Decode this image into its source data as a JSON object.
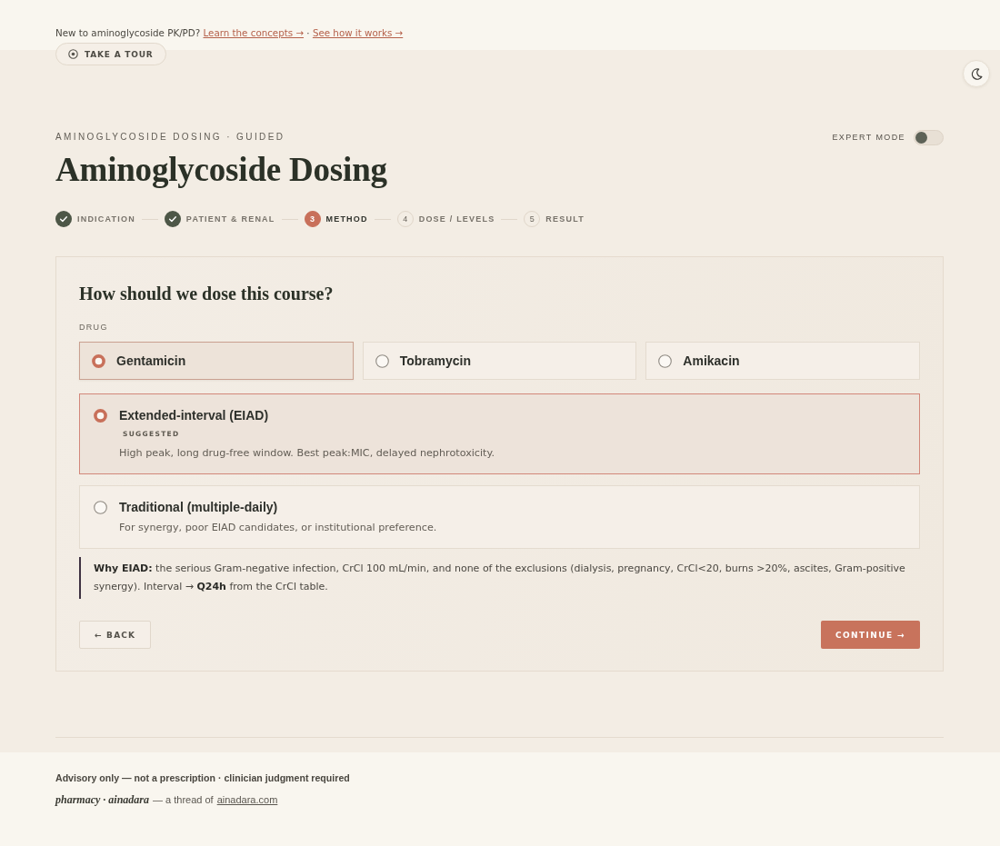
{
  "intro": {
    "text": "New to aminoglycoside PK/PD?",
    "links": [
      {
        "label": "Learn the concepts →"
      },
      {
        "label": "See how it works →"
      }
    ],
    "separator": "·"
  },
  "tour_button": {
    "label": "TAKE A TOUR"
  },
  "header": {
    "eyebrow": "AMINOGLYCOSIDE DOSING · GUIDED",
    "title": "Aminoglycoside Dosing",
    "expert_mode": {
      "label": "EXPERT MODE",
      "on": false
    }
  },
  "steps": [
    {
      "label": "INDICATION",
      "completed": true,
      "selected": false
    },
    {
      "label": "PATIENT & RENAL",
      "completed": true,
      "selected": false
    },
    {
      "number": "3",
      "label": "METHOD",
      "completed": false,
      "selected": true
    },
    {
      "number": "4",
      "label": "DOSE / LEVELS",
      "completed": false,
      "selected": false
    },
    {
      "number": "5",
      "label": "RESULT",
      "completed": false,
      "selected": false
    }
  ],
  "card": {
    "title": "How should we dose this course?",
    "drug": {
      "label": "DRUG",
      "options": [
        {
          "label": "Gentamicin",
          "selected": true
        },
        {
          "label": "Tobramycin",
          "selected": false
        },
        {
          "label": "Amikacin",
          "selected": false
        }
      ]
    },
    "methods": [
      {
        "title": "Extended-interval (EIAD)",
        "badge": "SUGGESTED",
        "description": "High peak, long drug-free window. Best peak:MIC, delayed nephrotoxicity.",
        "selected": true
      },
      {
        "title": "Traditional (multiple-daily)",
        "description": "For synergy, poor EIAD candidates, or institutional preference.",
        "selected": false
      }
    ],
    "rationale": "**Why EIAD:** the serious Gram-negative infection, CrCl 100 mL/min, and none of the exclusions (dialysis, pregnancy, CrCl<20, burns >20%, ascites, Gram-positive synergy). Interval → **Q24h** from the CrCl table.",
    "back_button": "← BACK",
    "continue_button": "CONTINUE →"
  },
  "footer": {
    "disclaimer": "Advisory only — not a prescription · clinician judgment required",
    "brand": "pharmacy · ainadara",
    "tagline": "— a thread of",
    "link": "ainadara.com"
  }
}
